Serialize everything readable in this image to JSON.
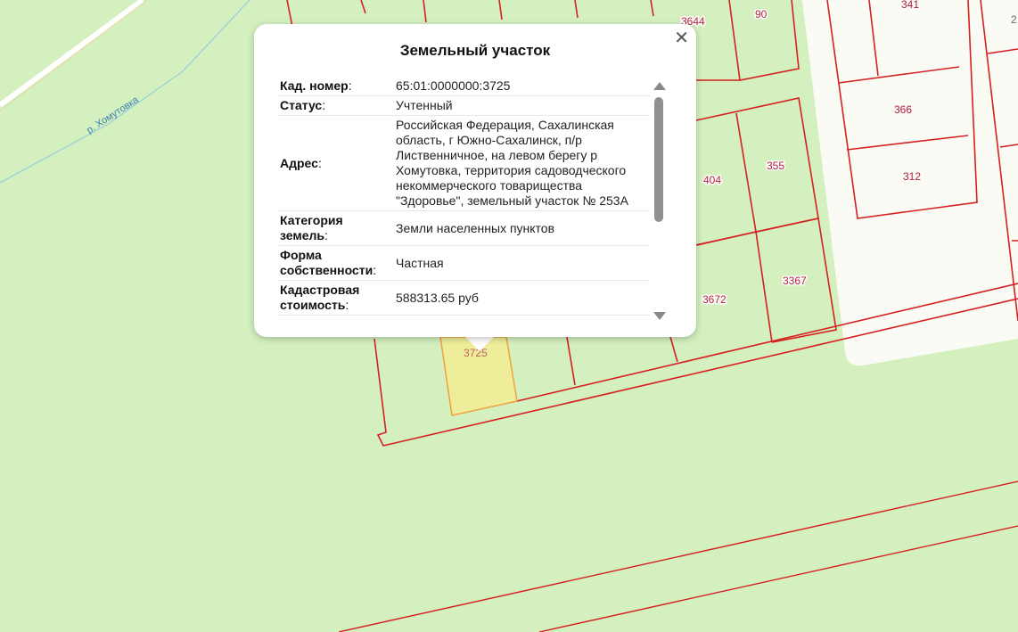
{
  "map": {
    "river_label": "р. Хомутовка",
    "parcels": [
      "3644",
      "90",
      "341",
      "366",
      "312",
      "404",
      "355",
      "3672",
      "3367",
      "3725",
      "2"
    ],
    "selected_parcel": "3725",
    "colors": {
      "background": "#d4f0bf",
      "boundary": "#d42020",
      "selected_fill": "#eeee9a",
      "selected_stroke": "#f0a040",
      "built_area": "#fbfbf6"
    }
  },
  "popup": {
    "title": "Земельный участок",
    "close_icon": "close-icon",
    "rows": [
      {
        "key": "Кад. номер",
        "value": "65:01:0000000:3725"
      },
      {
        "key": "Статус",
        "value": "Учтенный"
      },
      {
        "key": "Адрес",
        "value": "Российская Федерация, Сахалинская область, г Южно-Сахалинск, п/р Лиственничное, на левом берегу р Хомутовка, территория садоводческого некоммерческого товарищества \"Здоровье\", земельный участок № 253А"
      },
      {
        "key": "Категория земель",
        "value": "Земли населенных пунктов"
      },
      {
        "key": "Форма собственности",
        "value": "Частная"
      },
      {
        "key": "Кадастровая стоимость",
        "value": "588313.65 руб"
      }
    ]
  }
}
